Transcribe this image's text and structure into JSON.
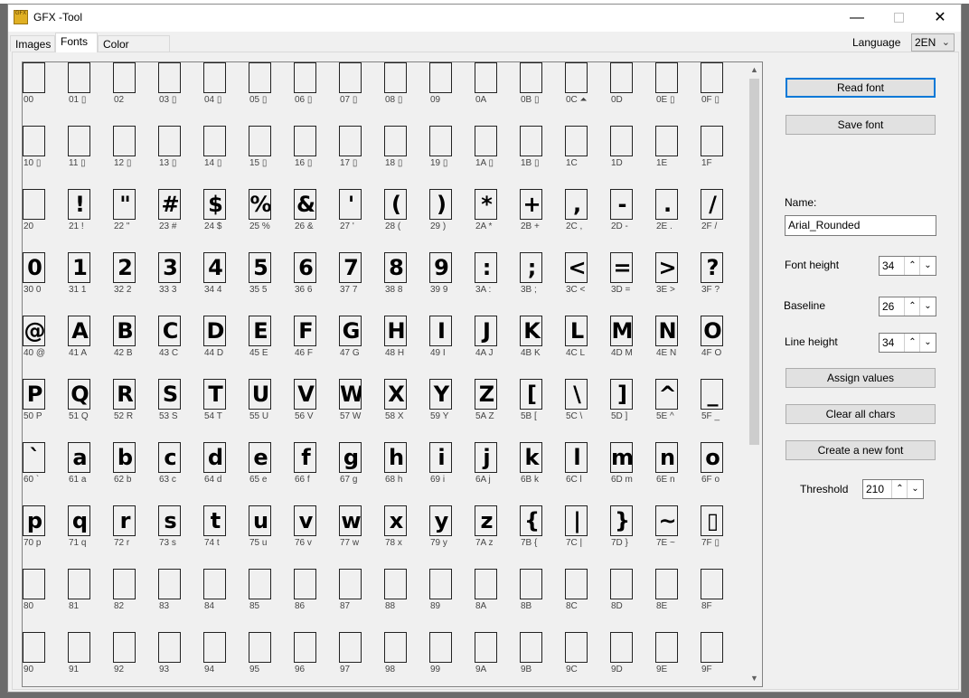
{
  "window": {
    "title": "GFX -Tool",
    "icon_text": "GFX",
    "minimize": "—",
    "close": "✕"
  },
  "tabs": [
    {
      "label": "Images"
    },
    {
      "label": "Fonts"
    },
    {
      "label": "Color palette"
    }
  ],
  "active_tab": "Fonts",
  "language": {
    "label": "Language",
    "value": "2EN"
  },
  "char_grid": {
    "cells": [
      {
        "label": "00",
        "glyph": ""
      },
      {
        "label": "01 ▯",
        "glyph": ""
      },
      {
        "label": "02",
        "glyph": ""
      },
      {
        "label": "03 ▯",
        "glyph": ""
      },
      {
        "label": "04 ▯",
        "glyph": ""
      },
      {
        "label": "05 ▯",
        "glyph": ""
      },
      {
        "label": "06 ▯",
        "glyph": ""
      },
      {
        "label": "07 ▯",
        "glyph": ""
      },
      {
        "label": "08 ▯",
        "glyph": ""
      },
      {
        "label": "09",
        "glyph": ""
      },
      {
        "label": "0A",
        "glyph": ""
      },
      {
        "label": "0B ▯",
        "glyph": ""
      },
      {
        "label": "0C ⏶",
        "glyph": ""
      },
      {
        "label": "0D",
        "glyph": ""
      },
      {
        "label": "0E ▯",
        "glyph": ""
      },
      {
        "label": "0F ▯",
        "glyph": ""
      },
      {
        "label": "10 ▯",
        "glyph": ""
      },
      {
        "label": "11 ▯",
        "glyph": ""
      },
      {
        "label": "12 ▯",
        "glyph": ""
      },
      {
        "label": "13 ▯",
        "glyph": ""
      },
      {
        "label": "14 ▯",
        "glyph": ""
      },
      {
        "label": "15 ▯",
        "glyph": ""
      },
      {
        "label": "16 ▯",
        "glyph": ""
      },
      {
        "label": "17 ▯",
        "glyph": ""
      },
      {
        "label": "18 ▯",
        "glyph": ""
      },
      {
        "label": "19 ▯",
        "glyph": ""
      },
      {
        "label": "1A ▯",
        "glyph": ""
      },
      {
        "label": "1B ▯",
        "glyph": ""
      },
      {
        "label": "1C",
        "glyph": ""
      },
      {
        "label": "1D",
        "glyph": ""
      },
      {
        "label": "1E",
        "glyph": ""
      },
      {
        "label": "1F",
        "glyph": ""
      },
      {
        "label": "20",
        "glyph": ""
      },
      {
        "label": "21 !",
        "glyph": "!"
      },
      {
        "label": "22 \"",
        "glyph": "\""
      },
      {
        "label": "23 #",
        "glyph": "#"
      },
      {
        "label": "24 $",
        "glyph": "$"
      },
      {
        "label": "25 %",
        "glyph": "%"
      },
      {
        "label": "26 &",
        "glyph": "&"
      },
      {
        "label": "27 '",
        "glyph": "'"
      },
      {
        "label": "28 (",
        "glyph": "("
      },
      {
        "label": "29 )",
        "glyph": ")"
      },
      {
        "label": "2A *",
        "glyph": "*"
      },
      {
        "label": "2B +",
        "glyph": "+"
      },
      {
        "label": "2C ,",
        "glyph": ","
      },
      {
        "label": "2D -",
        "glyph": "-"
      },
      {
        "label": "2E .",
        "glyph": "."
      },
      {
        "label": "2F /",
        "glyph": "/"
      },
      {
        "label": "30 0",
        "glyph": "0"
      },
      {
        "label": "31 1",
        "glyph": "1"
      },
      {
        "label": "32 2",
        "glyph": "2"
      },
      {
        "label": "33 3",
        "glyph": "3"
      },
      {
        "label": "34 4",
        "glyph": "4"
      },
      {
        "label": "35 5",
        "glyph": "5"
      },
      {
        "label": "36 6",
        "glyph": "6"
      },
      {
        "label": "37 7",
        "glyph": "7"
      },
      {
        "label": "38 8",
        "glyph": "8"
      },
      {
        "label": "39 9",
        "glyph": "9"
      },
      {
        "label": "3A :",
        "glyph": ":"
      },
      {
        "label": "3B ;",
        "glyph": ";"
      },
      {
        "label": "3C <",
        "glyph": "<"
      },
      {
        "label": "3D =",
        "glyph": "="
      },
      {
        "label": "3E >",
        "glyph": ">"
      },
      {
        "label": "3F ?",
        "glyph": "?"
      },
      {
        "label": "40 @",
        "glyph": "@"
      },
      {
        "label": "41 A",
        "glyph": "A"
      },
      {
        "label": "42 B",
        "glyph": "B"
      },
      {
        "label": "43 C",
        "glyph": "C"
      },
      {
        "label": "44 D",
        "glyph": "D"
      },
      {
        "label": "45 E",
        "glyph": "E"
      },
      {
        "label": "46 F",
        "glyph": "F"
      },
      {
        "label": "47 G",
        "glyph": "G"
      },
      {
        "label": "48 H",
        "glyph": "H"
      },
      {
        "label": "49 I",
        "glyph": "I"
      },
      {
        "label": "4A J",
        "glyph": "J"
      },
      {
        "label": "4B K",
        "glyph": "K"
      },
      {
        "label": "4C L",
        "glyph": "L"
      },
      {
        "label": "4D M",
        "glyph": "M"
      },
      {
        "label": "4E N",
        "glyph": "N"
      },
      {
        "label": "4F O",
        "glyph": "O"
      },
      {
        "label": "50 P",
        "glyph": "P"
      },
      {
        "label": "51 Q",
        "glyph": "Q"
      },
      {
        "label": "52 R",
        "glyph": "R"
      },
      {
        "label": "53 S",
        "glyph": "S"
      },
      {
        "label": "54 T",
        "glyph": "T"
      },
      {
        "label": "55 U",
        "glyph": "U"
      },
      {
        "label": "56 V",
        "glyph": "V"
      },
      {
        "label": "57 W",
        "glyph": "W"
      },
      {
        "label": "58 X",
        "glyph": "X"
      },
      {
        "label": "59 Y",
        "glyph": "Y"
      },
      {
        "label": "5A Z",
        "glyph": "Z"
      },
      {
        "label": "5B [",
        "glyph": "["
      },
      {
        "label": "5C \\",
        "glyph": "\\"
      },
      {
        "label": "5D ]",
        "glyph": "]"
      },
      {
        "label": "5E ^",
        "glyph": "^"
      },
      {
        "label": "5F _",
        "glyph": "_"
      },
      {
        "label": "60 `",
        "glyph": "`"
      },
      {
        "label": "61 a",
        "glyph": "a"
      },
      {
        "label": "62 b",
        "glyph": "b"
      },
      {
        "label": "63 c",
        "glyph": "c"
      },
      {
        "label": "64 d",
        "glyph": "d"
      },
      {
        "label": "65 e",
        "glyph": "e"
      },
      {
        "label": "66 f",
        "glyph": "f"
      },
      {
        "label": "67 g",
        "glyph": "g"
      },
      {
        "label": "68 h",
        "glyph": "h"
      },
      {
        "label": "69 i",
        "glyph": "i"
      },
      {
        "label": "6A j",
        "glyph": "j"
      },
      {
        "label": "6B k",
        "glyph": "k"
      },
      {
        "label": "6C l",
        "glyph": "l"
      },
      {
        "label": "6D m",
        "glyph": "m"
      },
      {
        "label": "6E n",
        "glyph": "n"
      },
      {
        "label": "6F o",
        "glyph": "o"
      },
      {
        "label": "70 p",
        "glyph": "p"
      },
      {
        "label": "71 q",
        "glyph": "q"
      },
      {
        "label": "72 r",
        "glyph": "r"
      },
      {
        "label": "73 s",
        "glyph": "s"
      },
      {
        "label": "74 t",
        "glyph": "t"
      },
      {
        "label": "75 u",
        "glyph": "u"
      },
      {
        "label": "76 v",
        "glyph": "v"
      },
      {
        "label": "77 w",
        "glyph": "w"
      },
      {
        "label": "78 x",
        "glyph": "x"
      },
      {
        "label": "79 y",
        "glyph": "y"
      },
      {
        "label": "7A z",
        "glyph": "z"
      },
      {
        "label": "7B {",
        "glyph": "{"
      },
      {
        "label": "7C |",
        "glyph": "|"
      },
      {
        "label": "7D }",
        "glyph": "}"
      },
      {
        "label": "7E ~",
        "glyph": "~"
      },
      {
        "label": "7F ▯",
        "glyph": "▯"
      },
      {
        "label": "80",
        "glyph": ""
      },
      {
        "label": "81",
        "glyph": ""
      },
      {
        "label": "82",
        "glyph": ""
      },
      {
        "label": "83",
        "glyph": ""
      },
      {
        "label": "84",
        "glyph": ""
      },
      {
        "label": "85",
        "glyph": ""
      },
      {
        "label": "86",
        "glyph": ""
      },
      {
        "label": "87",
        "glyph": ""
      },
      {
        "label": "88",
        "glyph": ""
      },
      {
        "label": "89",
        "glyph": ""
      },
      {
        "label": "8A",
        "glyph": ""
      },
      {
        "label": "8B",
        "glyph": ""
      },
      {
        "label": "8C",
        "glyph": ""
      },
      {
        "label": "8D",
        "glyph": ""
      },
      {
        "label": "8E",
        "glyph": ""
      },
      {
        "label": "8F",
        "glyph": ""
      },
      {
        "label": "90",
        "glyph": ""
      },
      {
        "label": "91",
        "glyph": ""
      },
      {
        "label": "92",
        "glyph": ""
      },
      {
        "label": "93",
        "glyph": ""
      },
      {
        "label": "94",
        "glyph": ""
      },
      {
        "label": "95",
        "glyph": ""
      },
      {
        "label": "96",
        "glyph": ""
      },
      {
        "label": "97",
        "glyph": ""
      },
      {
        "label": "98",
        "glyph": ""
      },
      {
        "label": "99",
        "glyph": ""
      },
      {
        "label": "9A",
        "glyph": ""
      },
      {
        "label": "9B",
        "glyph": ""
      },
      {
        "label": "9C",
        "glyph": ""
      },
      {
        "label": "9D",
        "glyph": ""
      },
      {
        "label": "9E",
        "glyph": ""
      },
      {
        "label": "9F",
        "glyph": ""
      }
    ],
    "scroll_up_icon": "▲",
    "scroll_down_icon": "▼"
  },
  "panel": {
    "read_font": "Read font",
    "save_font": "Save font",
    "name_label": "Name:",
    "name_value": "Arial_Rounded",
    "font_height_label": "Font height",
    "font_height_value": "34",
    "baseline_label": "Baseline",
    "baseline_value": "26",
    "line_height_label": "Line height",
    "line_height_value": "34",
    "assign_values": "Assign values",
    "clear_all_chars": "Clear all chars",
    "create_new_font": "Create a new font",
    "threshold_label": "Threshold",
    "threshold_value": "210",
    "spin_up_icon": "⌃",
    "spin_down_icon": "⌄"
  },
  "colors": {
    "accent": "#0078d7",
    "window_bg": "#f0f0f0",
    "button_bg": "#e1e1e1"
  }
}
